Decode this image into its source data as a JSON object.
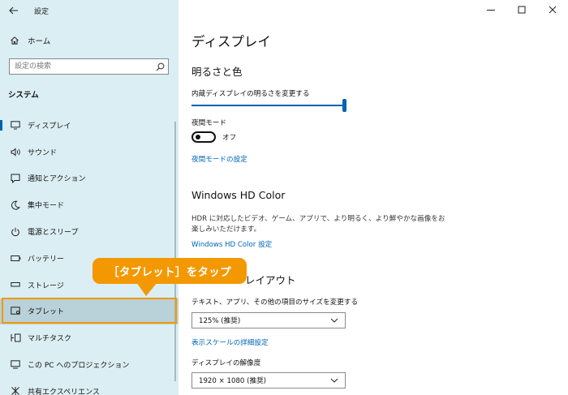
{
  "window": {
    "back_icon": "arrow-left-icon",
    "title": "設定",
    "controls": [
      "minimize-icon",
      "maximize-icon",
      "close-icon"
    ]
  },
  "sidebar": {
    "home_label": "ホーム",
    "search_placeholder": "設定の検索",
    "section": "システム",
    "items": [
      {
        "label": "ディスプレイ",
        "icon": "monitor-icon",
        "active": true
      },
      {
        "label": "サウンド",
        "icon": "speaker-icon"
      },
      {
        "label": "通知とアクション",
        "icon": "notification-icon"
      },
      {
        "label": "集中モード",
        "icon": "moon-icon"
      },
      {
        "label": "電源とスリープ",
        "icon": "power-icon"
      },
      {
        "label": "バッテリー",
        "icon": "battery-icon"
      },
      {
        "label": "ストレージ",
        "icon": "storage-icon"
      },
      {
        "label": "タブレット",
        "icon": "tablet-icon",
        "highlighted": true
      },
      {
        "label": "マルチタスク",
        "icon": "multitask-icon"
      },
      {
        "label": "この PC へのプロジェクション",
        "icon": "projection-icon"
      },
      {
        "label": "共有エクスペリエンス",
        "icon": "share-icon"
      }
    ]
  },
  "main": {
    "title": "ディスプレイ",
    "brightness": {
      "heading": "明るさと色",
      "slider_label": "内蔵ディスプレイの明るさを変更する",
      "level": 1.0
    },
    "night_light": {
      "label": "夜間モード",
      "state": "オフ",
      "settings_link": "夜間モードの設定"
    },
    "hd_color": {
      "heading": "Windows HD Color",
      "description": "HDR に対応したビデオ、ゲーム、アプリで、より明るく、より鮮やかな画像をお楽しみいただけます。",
      "link": "Windows HD Color 設定"
    },
    "layout": {
      "heading_visible": "レイアウト",
      "scale_label": "テキスト、アプリ、その他の項目のサイズを変更する",
      "scale_value": "125% (推奨)",
      "advanced_link": "表示スケールの詳細設定",
      "resolution_label": "ディスプレイの解像度",
      "resolution_value": "1920 × 1080 (推奨)"
    }
  },
  "callout": {
    "text": "［タブレット］をタップ",
    "color": "#f39800"
  },
  "colors": {
    "sidebar_bg": "#dbeef4",
    "accent": "#0063b1",
    "link": "#0066b4",
    "highlight_border": "#f39800"
  }
}
